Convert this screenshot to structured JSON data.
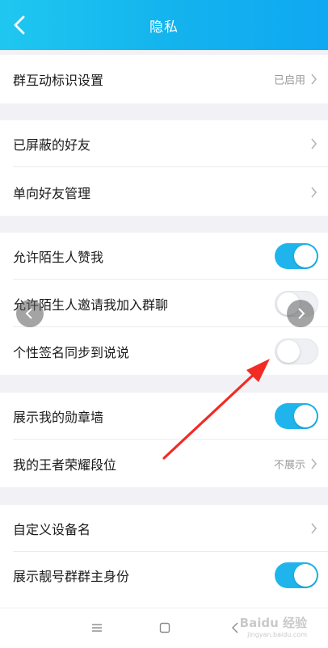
{
  "header": {
    "title": "隐私"
  },
  "rows": {
    "group_badge": {
      "label": "群互动标识设置",
      "value": "已启用"
    },
    "blocked_friends": {
      "label": "已屏蔽的好友"
    },
    "oneway_friends": {
      "label": "单向好友管理"
    },
    "stranger_like": {
      "label": "允许陌生人赞我",
      "toggle": true
    },
    "stranger_invite": {
      "label": "允许陌生人邀请我加入群聊",
      "toggle": false
    },
    "signature_sync": {
      "label": "个性签名同步到说说",
      "toggle": false
    },
    "medal_wall": {
      "label": "展示我的勋章墙",
      "toggle": true
    },
    "king_rank": {
      "label": "我的王者荣耀段位",
      "value": "不展示"
    },
    "device_name": {
      "label": "自定义设备名"
    },
    "group_owner": {
      "label": "展示靓号群群主身份",
      "toggle": true
    }
  },
  "watermark": {
    "text": "Baidu 经验",
    "sub": "jingyan.baidu.com"
  },
  "colors": {
    "accent": "#1fb5ec",
    "arrow": "#f22b24"
  },
  "icons": [
    "back-arrow-icon",
    "chevron-right-icon",
    "menu-lines-icon",
    "home-square-icon",
    "nav-back-icon",
    "carousel-prev-icon",
    "carousel-next-icon"
  ]
}
